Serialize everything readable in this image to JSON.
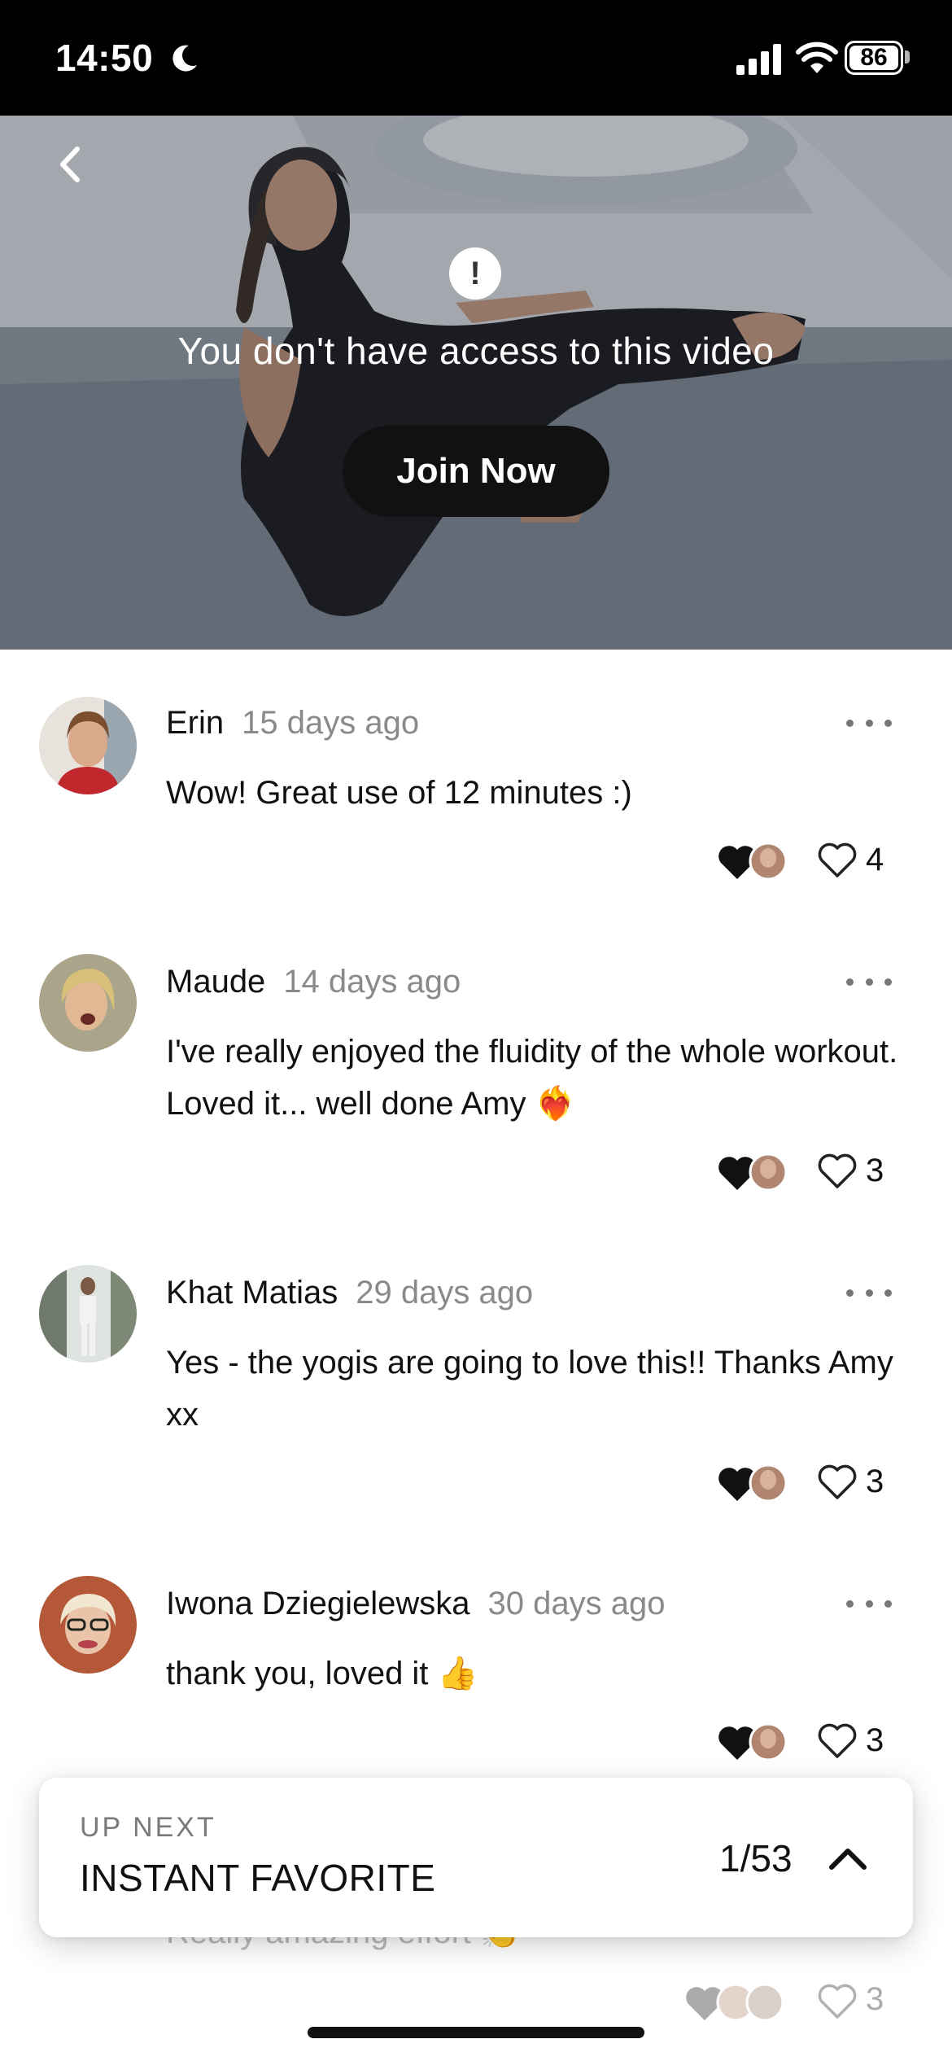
{
  "status_bar": {
    "time": "14:50",
    "battery": "86",
    "icons": [
      "moon-icon",
      "signal-icon",
      "wifi-icon",
      "battery-icon"
    ]
  },
  "video": {
    "message": "You don't have access to this video",
    "join_label": "Join Now",
    "alert_glyph": "!"
  },
  "comments": [
    {
      "name": "Erin",
      "date": "15 days ago",
      "text": "Wow! Great use of 12 minutes :)",
      "likes": "4"
    },
    {
      "name": "Maude",
      "date": "14 days ago",
      "text": "I've really enjoyed the fluidity of the whole workout. Loved it... well done Amy ❤️‍🔥",
      "likes": "3"
    },
    {
      "name": "Khat Matias",
      "date": "29 days ago",
      "text": "Yes - the yogis are going to love this!! Thanks Amy xx",
      "likes": "3"
    },
    {
      "name": "Iwona Dziegielewska",
      "date": "30 days ago",
      "text": "thank you, loved it 👍",
      "likes": "3"
    }
  ],
  "faded_comment": {
    "text": "Really amazing effort 👏",
    "likes": "3"
  },
  "up_next": {
    "label": "UP NEXT",
    "title": "INSTANT FAVORITE",
    "count": "1/53"
  },
  "colors": {
    "status_bg": "#000000",
    "join_bg": "#111111",
    "muted_text": "#8a8a8a"
  }
}
